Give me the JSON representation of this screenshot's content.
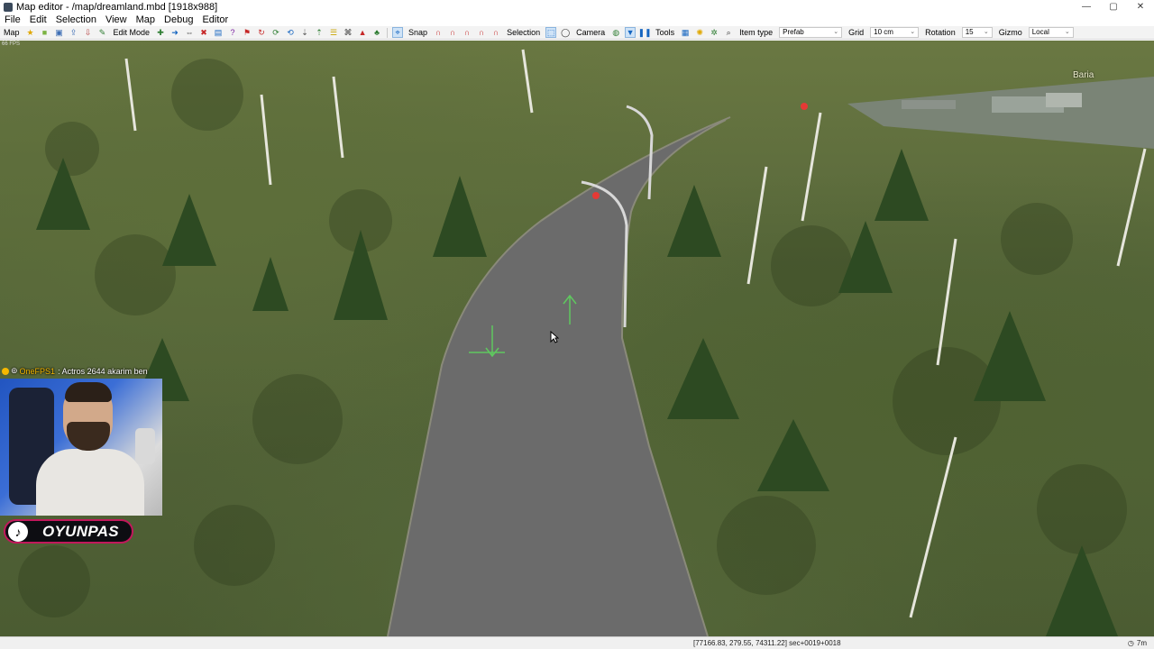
{
  "window": {
    "title": "Map editor - /map/dreamland.mbd [1918x988]",
    "minimize": "—",
    "maximize": "▢",
    "close": "✕"
  },
  "menu": [
    "File",
    "Edit",
    "Selection",
    "View",
    "Map",
    "Debug",
    "Editor"
  ],
  "toolbar": {
    "map_label": "Map",
    "edit_mode_label": "Edit Mode",
    "snap_label": "Snap",
    "selection_label": "Selection",
    "camera_label": "Camera",
    "tools_label": "Tools",
    "item_type_label": "Item type",
    "item_type_value": "Prefab",
    "grid_label": "Grid",
    "grid_value": "10 cm",
    "rotation_label": "Rotation",
    "rotation_value": "15",
    "gizmo_label": "Gizmo",
    "gizmo_value": "Local"
  },
  "viewport": {
    "city_label": "Baria"
  },
  "overlay": {
    "chat_user": "OneFPS1",
    "chat_message": ": Actros 2644 akarim ben",
    "tiktok_handle": "OYUNPAS"
  },
  "status": {
    "coords": "[77166.83, 279.55, 74311.22] sec+0019+0018",
    "right": "7m"
  },
  "colors": {
    "grass": "#56663a",
    "road": "#6b6b6b",
    "accent_tiktok": "#c2185b"
  }
}
